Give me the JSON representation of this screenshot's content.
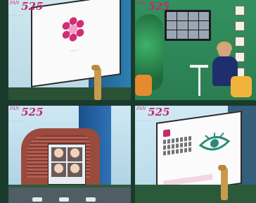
{
  "logo": {
    "brand": "FAN",
    "number": "525",
    "tag_left": "········",
    "tag_right": "······"
  },
  "panels": [
    {
      "id": "top-left",
      "screen_caption": "········"
    },
    {
      "id": "top-right"
    },
    {
      "id": "bottom-left"
    },
    {
      "id": "bottom-right"
    }
  ],
  "colors": {
    "brand_pink": "#c42a6a",
    "sky": "#cfe6ef",
    "green_wall": "#2f8a5a",
    "tower_blue": "#2d7fb3"
  }
}
